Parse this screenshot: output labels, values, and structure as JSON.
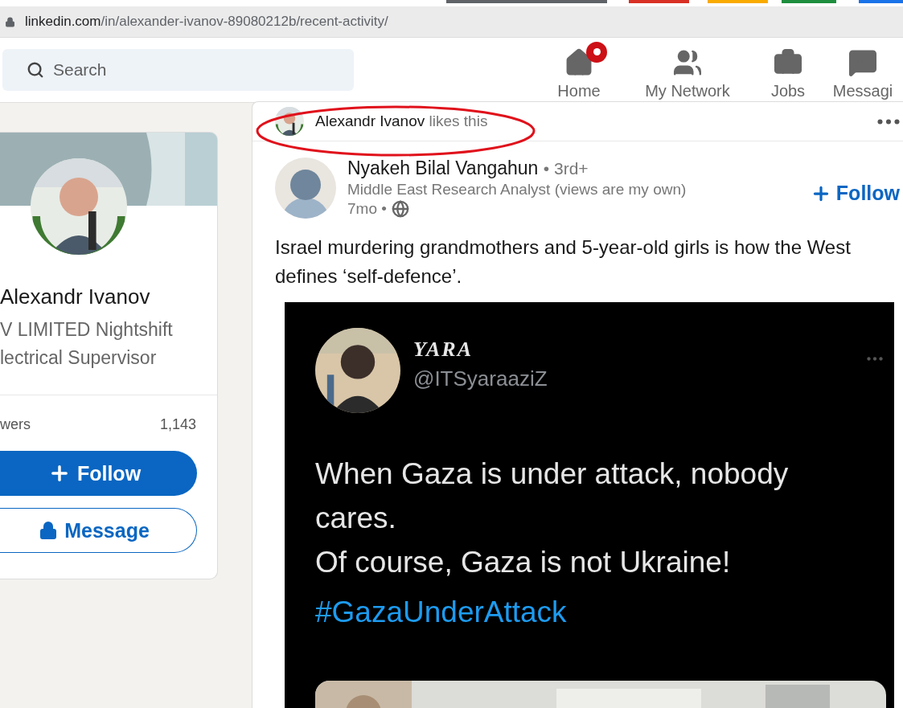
{
  "browser": {
    "url_host": "linkedin.com",
    "url_path": "/in/alexander-ivanov-89080212b/recent-activity/"
  },
  "nav": {
    "search": {
      "placeholder": "Search"
    },
    "items": [
      {
        "label": "Home",
        "kind": "home",
        "badge": true
      },
      {
        "label": "My Network",
        "kind": "network",
        "badge": false
      },
      {
        "label": "Jobs",
        "kind": "jobs",
        "badge": false
      },
      {
        "label": "Messagi",
        "kind": "messaging",
        "badge": false
      }
    ]
  },
  "profile_card": {
    "name": "Alexandr Ivanov",
    "headline": [
      "V LIMITED Nightshift",
      "lectrical Supervisor"
    ],
    "stat": {
      "label": "wers",
      "value": "1,143"
    },
    "buttons": [
      {
        "label": "Follow",
        "kind": "primary"
      },
      {
        "label": "Message",
        "kind": "secondary"
      }
    ]
  },
  "post": {
    "activity": {
      "actor": "Alexandr Ivanov",
      "action": "likes this",
      "highlighted": true
    },
    "author": {
      "name": "Nyakeh Bilal Vangahun",
      "degree": "• 3rd+",
      "headline": "Middle East Research Analyst (views are my own)",
      "time": "7mo •"
    },
    "follow": "Follow",
    "text": "Israel murdering grandmothers and 5-year-old girls is how the West defines ‘self-defence’.",
    "embed": {
      "display_name": "YARA",
      "handle": "@ITSyaraaziZ",
      "paragraphs": [
        "When Gaza is under attack, nobody cares.",
        "Of course, Gaza is not Ukraine!"
      ],
      "hashtag": "#GazaUnderAttack"
    }
  }
}
